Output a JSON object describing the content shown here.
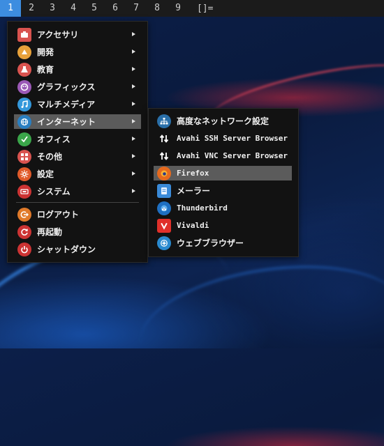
{
  "topbar": {
    "workspaces": [
      "1",
      "2",
      "3",
      "4",
      "5",
      "6",
      "7",
      "8",
      "9"
    ],
    "active_workspace": "1",
    "layout_indicator": "[]="
  },
  "colors": {
    "topbar_bg": "#1b1b1b",
    "active_workspace": "#3d8de0",
    "menu_bg": "#121212",
    "highlight": "#5b5b5b"
  },
  "main_menu": {
    "items": [
      {
        "label": "アクセサリ",
        "icon": "accessories-icon",
        "color": "#d9534f"
      },
      {
        "label": "開発",
        "icon": "development-icon",
        "color": "#e8a13a"
      },
      {
        "label": "教育",
        "icon": "education-icon",
        "color": "#d9534f"
      },
      {
        "label": "グラフィックス",
        "icon": "graphics-icon",
        "color": "#9b59b6"
      },
      {
        "label": "マルチメディア",
        "icon": "multimedia-icon",
        "color": "#3498db"
      },
      {
        "label": "インターネット",
        "icon": "internet-icon",
        "color": "#2a7fc1"
      },
      {
        "label": "オフィス",
        "icon": "office-icon",
        "color": "#3aa64a"
      },
      {
        "label": "その他",
        "icon": "other-icon",
        "color": "#d9534f"
      },
      {
        "label": "設定",
        "icon": "settings-icon",
        "color": "#e05a2a"
      },
      {
        "label": "システム",
        "icon": "system-icon",
        "color": "#cc3333"
      }
    ],
    "actions": [
      {
        "label": "ログアウト",
        "icon": "logout-icon",
        "color": "#e07a2a"
      },
      {
        "label": "再起動",
        "icon": "reboot-icon",
        "color": "#cc3333"
      },
      {
        "label": "シャットダウン",
        "icon": "shutdown-icon",
        "color": "#cc3333"
      }
    ]
  },
  "submenu": {
    "items": [
      {
        "label": "高度なネットワーク設定",
        "icon": "network-icon"
      },
      {
        "label": "Avahi SSH Server Browser",
        "icon": "updown-arrows-icon"
      },
      {
        "label": "Avahi VNC Server Browser",
        "icon": "updown-arrows-icon"
      },
      {
        "label": "Firefox",
        "icon": "firefox-icon"
      },
      {
        "label": "メーラー",
        "icon": "mailer-icon"
      },
      {
        "label": "Thunderbird",
        "icon": "thunderbird-icon"
      },
      {
        "label": "Vivaldi",
        "icon": "vivaldi-icon"
      },
      {
        "label": "ウェブブラウザー",
        "icon": "web-browser-icon"
      }
    ]
  }
}
